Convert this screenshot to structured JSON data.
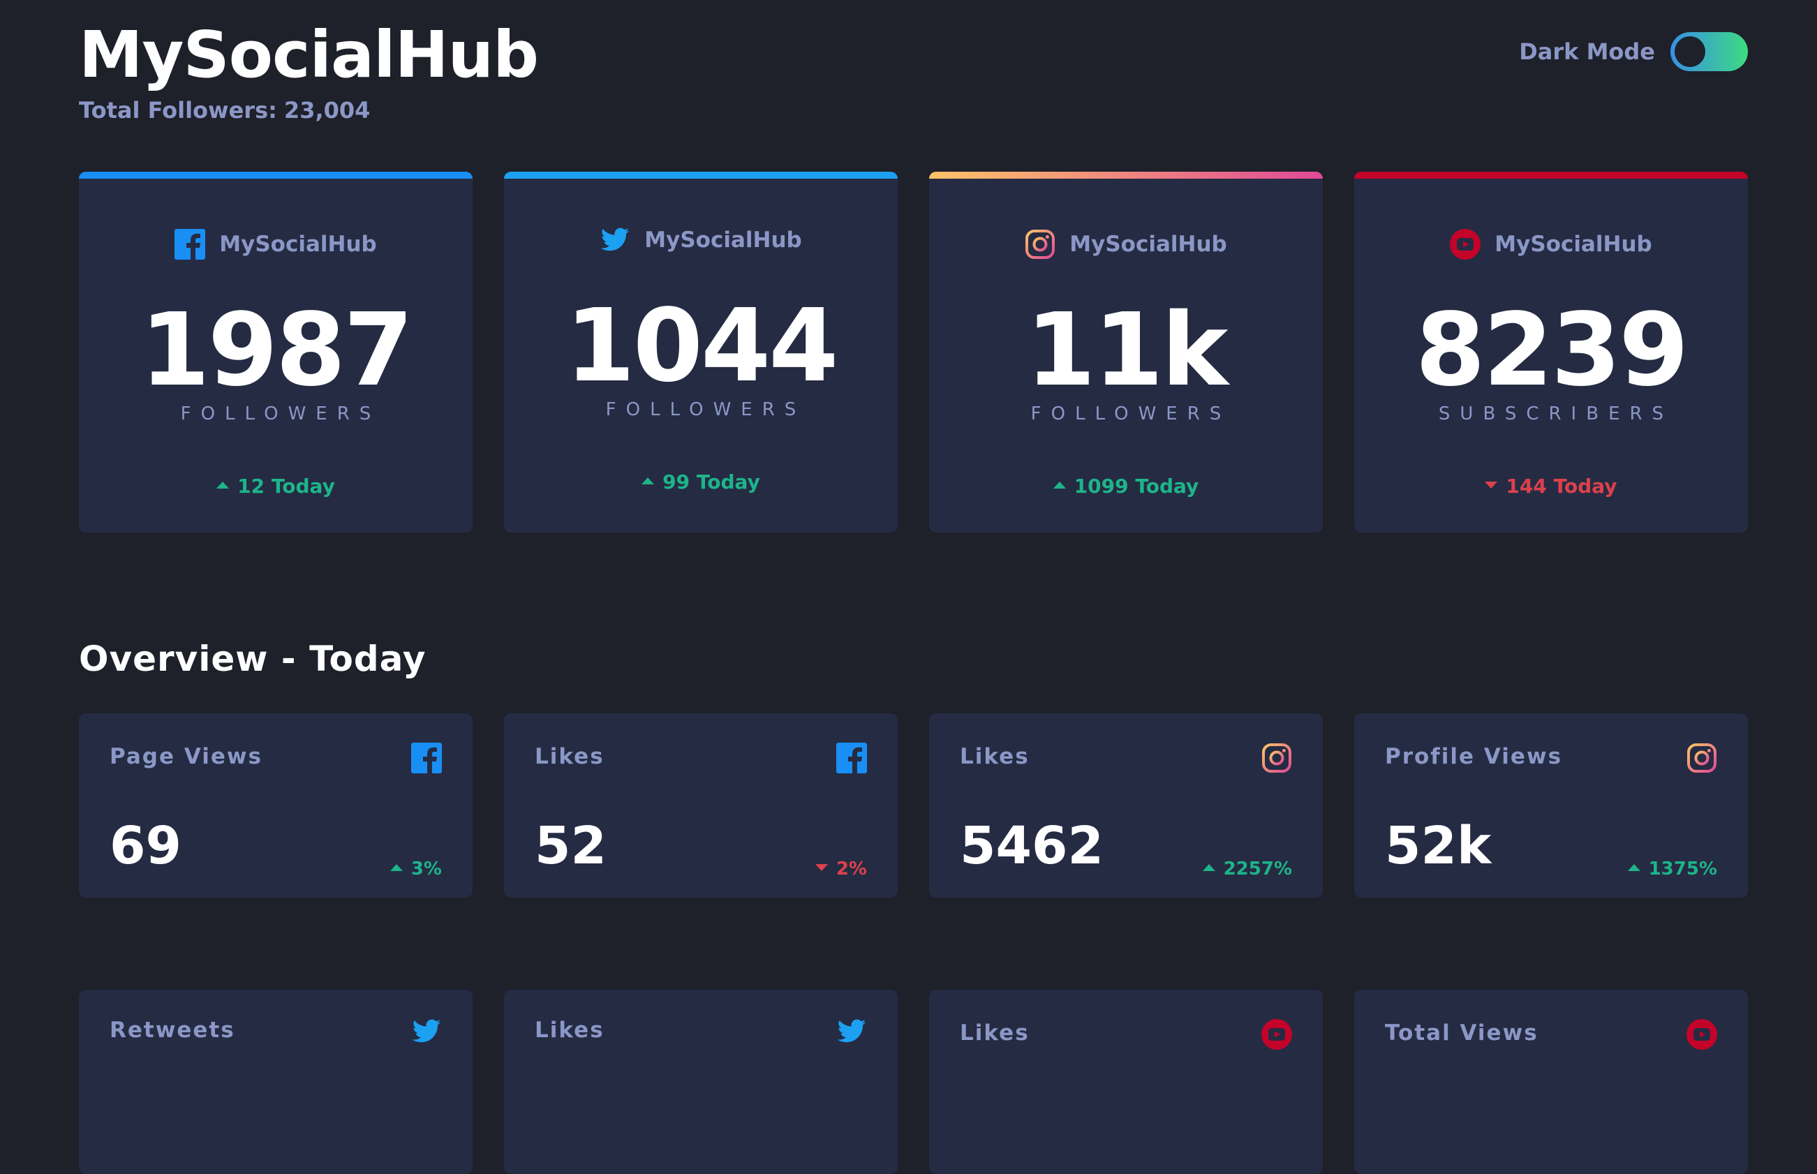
{
  "header": {
    "title": "MySocialHub",
    "total_followers_label": "Total Followers:",
    "total_followers_value": "23,004",
    "dark_mode_label": "Dark Mode",
    "dark_mode_on": true
  },
  "colors": {
    "background": "#1e202a",
    "card": "#252b43",
    "muted_text": "#8b97c6",
    "up": "#1db489",
    "down": "#dc414c",
    "facebook": "#198ff5",
    "twitter": "#1ca0f2",
    "instagram_gradient": [
      "#fdc468",
      "#df4996"
    ],
    "youtube": "#c4032a"
  },
  "follower_cards": [
    {
      "platform": "facebook",
      "icon": "facebook-icon",
      "handle": "MySocialHub",
      "count": "1987",
      "label": "FOLLOWERS",
      "change": "12 Today",
      "direction": "up"
    },
    {
      "platform": "twitter",
      "icon": "twitter-icon",
      "handle": "MySocialHub",
      "count": "1044",
      "label": "FOLLOWERS",
      "change": "99 Today",
      "direction": "up"
    },
    {
      "platform": "instagram",
      "icon": "instagram-icon",
      "handle": "MySocialHub",
      "count": "11k",
      "label": "FOLLOWERS",
      "change": "1099 Today",
      "direction": "up"
    },
    {
      "platform": "youtube",
      "icon": "youtube-icon",
      "handle": "MySocialHub",
      "count": "8239",
      "label": "SUBSCRIBERS",
      "change": "144 Today",
      "direction": "down"
    }
  ],
  "overview": {
    "title": "Overview - Today",
    "cards": [
      {
        "label": "Page Views",
        "platform": "facebook",
        "icon": "facebook-icon",
        "value": "69",
        "change": "3%",
        "direction": "up"
      },
      {
        "label": "Likes",
        "platform": "facebook",
        "icon": "facebook-icon",
        "value": "52",
        "change": "2%",
        "direction": "down"
      },
      {
        "label": "Likes",
        "platform": "instagram",
        "icon": "instagram-icon",
        "value": "5462",
        "change": "2257%",
        "direction": "up"
      },
      {
        "label": "Profile Views",
        "platform": "instagram",
        "icon": "instagram-icon",
        "value": "52k",
        "change": "1375%",
        "direction": "up"
      },
      {
        "label": "Retweets",
        "platform": "twitter",
        "icon": "twitter-icon"
      },
      {
        "label": "Likes",
        "platform": "twitter",
        "icon": "twitter-icon"
      },
      {
        "label": "Likes",
        "platform": "youtube",
        "icon": "youtube-icon"
      },
      {
        "label": "Total Views",
        "platform": "youtube",
        "icon": "youtube-icon"
      }
    ]
  }
}
